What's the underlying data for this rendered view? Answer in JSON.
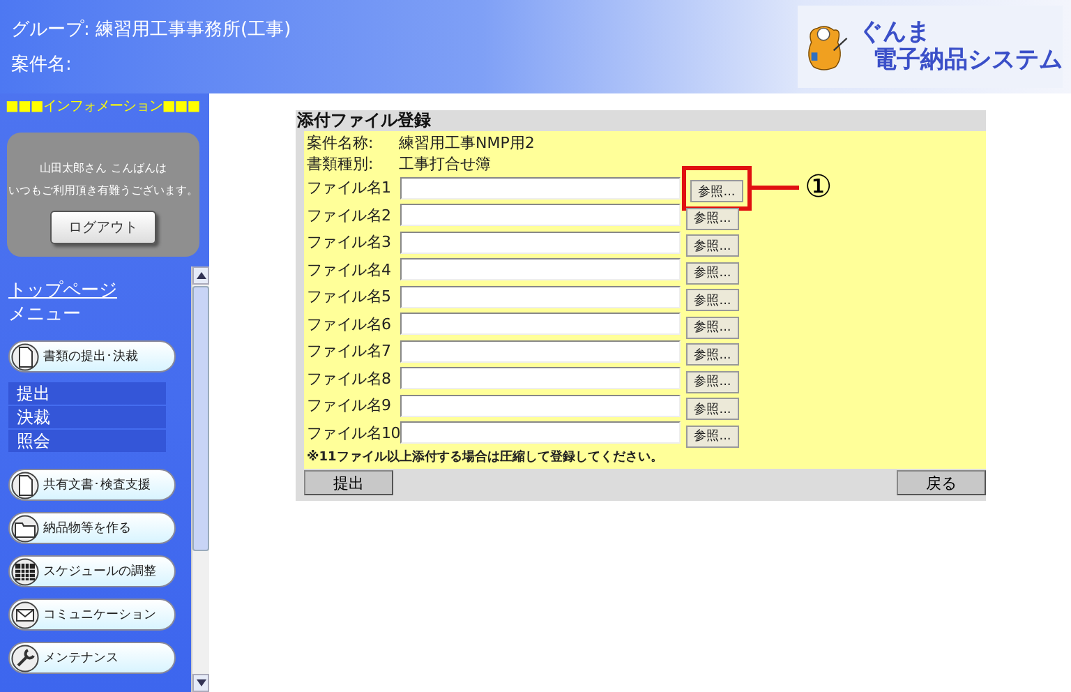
{
  "header": {
    "group": "グループ: 練習用工事事務所(工事)",
    "project": "案件名:",
    "logo_top": "ぐんま",
    "logo_bottom": "電子納品システム"
  },
  "sidebar": {
    "info_label": "■■■インフォメーション■■■",
    "greeting": "山田太郎さん こんばんは",
    "thanks": "いつもご利用頂き有難うございます。",
    "logout": "ログアウト",
    "top_link": "トップページ",
    "menu_label": "メニュー",
    "menu": [
      {
        "kind": "document",
        "label": "書類の提出･決裁",
        "children": [
          {
            "label": "提出"
          },
          {
            "label": "決裁"
          },
          {
            "label": "照会"
          }
        ]
      },
      {
        "kind": "document",
        "label": "共有文書･検査支援"
      },
      {
        "kind": "folder",
        "label": "納品物等を作る"
      },
      {
        "kind": "calendar",
        "label": "スケジュールの調整"
      },
      {
        "kind": "mail",
        "label": "コミュニケーション"
      },
      {
        "kind": "wrench",
        "label": "メンテナンス"
      }
    ]
  },
  "form": {
    "title": "添付ファイル登録",
    "project_label": "案件名称:",
    "project_value": "練習用工事NMP用2",
    "type_label": "書類種別:",
    "type_value": "工事打合せ簿",
    "files": [
      {
        "label": "ファイル名1",
        "button": "参照...",
        "highlighted": true,
        "callout": "①"
      },
      {
        "label": "ファイル名2",
        "button": "参照...",
        "highlighted": false
      },
      {
        "label": "ファイル名3",
        "button": "参照...",
        "highlighted": false
      },
      {
        "label": "ファイル名4",
        "button": "参照...",
        "highlighted": false
      },
      {
        "label": "ファイル名5",
        "button": "参照...",
        "highlighted": false
      },
      {
        "label": "ファイル名6",
        "button": "参照...",
        "highlighted": false
      },
      {
        "label": "ファイル名7",
        "button": "参照...",
        "highlighted": false
      },
      {
        "label": "ファイル名8",
        "button": "参照...",
        "highlighted": false
      },
      {
        "label": "ファイル名9",
        "button": "参照...",
        "highlighted": false
      },
      {
        "label": "ファイル名10",
        "button": "参照...",
        "highlighted": false
      }
    ],
    "note": "※11ファイル以上添付する場合は圧縮して登録してください。",
    "submit": "提出",
    "back": "戻る"
  }
}
